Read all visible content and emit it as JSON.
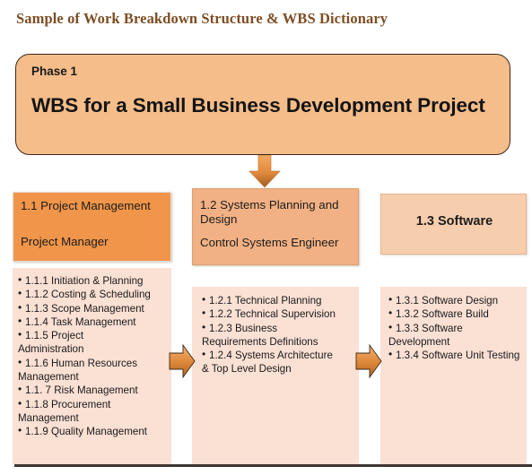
{
  "title": "Sample of Work Breakdown Structure & WBS Dictionary",
  "phase": {
    "label": "Phase 1",
    "heading": "WBS for a Small Business Development Project"
  },
  "colors": {
    "title": "#7d4e25",
    "phase_fill": "#f5bd8a",
    "col1_header_fill": "#f09549",
    "col2_header_fill": "#f2b184",
    "col3_header_fill": "#f7cead",
    "panel_fill": "#fbe0d4",
    "arrow_fill": "#e08a3c"
  },
  "columns": [
    {
      "id": "1.1",
      "header_line1": "1.1 Project Management",
      "header_line2": "Project Manager",
      "items": [
        "1.1.1 Initiation  & Planning",
        "1.1.2 Costing & Scheduling",
        "1.1.3 Scope Management",
        "1.1.4 Task  Management",
        "1.1.5 Project",
        "Administration",
        "1.1.6 Human  Resources",
        "Management",
        "1.1. 7 Risk  Management",
        "1.1.8 Procurement",
        "Management",
        "1.1.9 Quality  Management"
      ],
      "bullets": [
        {
          "text": "1.1.1 Initiation  & Planning",
          "cont": null
        },
        {
          "text": "1.1.2 Costing & Scheduling",
          "cont": null
        },
        {
          "text": "1.1.3 Scope Management",
          "cont": null
        },
        {
          "text": "1.1.4 Task  Management",
          "cont": null
        },
        {
          "text": "1.1.5 Project",
          "cont": "Administration"
        },
        {
          "text": "1.1.6 Human  Resources",
          "cont": "Management"
        },
        {
          "text": "1.1. 7 Risk  Management",
          "cont": null
        },
        {
          "text": "1.1.8 Procurement",
          "cont": "Management"
        },
        {
          "text": "1.1.9 Quality  Management",
          "cont": null
        }
      ]
    },
    {
      "id": "1.2",
      "header_line1": "1.2  Systems Planning and Design",
      "header_line2": "Control Systems Engineer",
      "bullets": [
        {
          "text": "1.2.1 Technical Planning",
          "cont": null
        },
        {
          "text": "1.2.2 Technical Supervision",
          "cont": null
        },
        {
          "text": "1.2.3 Business",
          "cont": "Requirements Definitions"
        },
        {
          "text": "1.2.4 Systems Architecture",
          "cont": "& Top  Level Design"
        }
      ]
    },
    {
      "id": "1.3",
      "header_line1": "1.3 Software",
      "header_line2": "",
      "bullets": [
        {
          "text": "1.3.1 Software  Design",
          "cont": null
        },
        {
          "text": "1.3.2 Software  Build",
          "cont": null
        },
        {
          "text": "1.3.3 Software",
          "cont": "Development"
        },
        {
          "text": "1.3.4 Software  Unit Testing",
          "cont": null
        }
      ]
    }
  ],
  "arrows": {
    "down": "down-arrow",
    "right_1": "right-arrow",
    "right_2": "right-arrow"
  }
}
